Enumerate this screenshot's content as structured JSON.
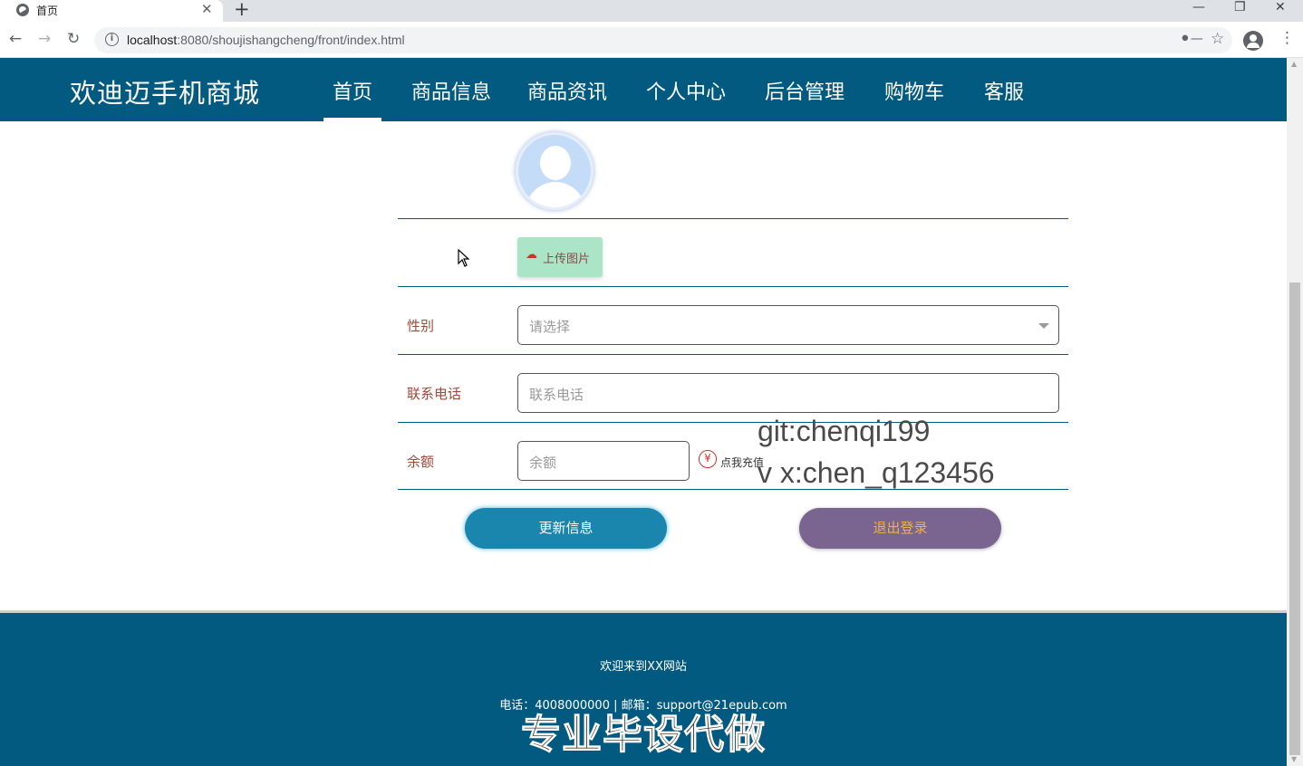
{
  "browser": {
    "tab_title": "首页",
    "tab_close": "✕",
    "new_tab": "+",
    "url_host": "localhost",
    "url_rest": ":8080/shoujishangcheng/front/index.html",
    "minimize": "—",
    "restore": "❐",
    "close": "✕"
  },
  "site": {
    "logo": "欢迪迈手机商城",
    "nav": [
      "首页",
      "商品信息",
      "商品资讯",
      "个人中心",
      "后台管理",
      "购物车",
      "客服"
    ],
    "active_nav": "首页"
  },
  "form": {
    "upload_label": "上传图片",
    "gender_label": "性别",
    "gender_placeholder": "请选择",
    "phone_label": "联系电话",
    "phone_placeholder": "联系电话",
    "balance_label": "余额",
    "balance_placeholder": "余额",
    "recharge_symbol": "¥",
    "recharge_label": "点我充值",
    "update_button": "更新信息",
    "logout_button": "退出登录"
  },
  "overlay": {
    "git": "git:chenqi199",
    "wx": "v x:chen_q123456"
  },
  "footer": {
    "welcome": "欢迎来到XX网站",
    "contact": "电话：4008000000 | 邮箱：support@21epub.com",
    "stamp": "专业毕设代做"
  },
  "colors": {
    "header_bg": "#035a80",
    "update_button_bg": "#1b86ad",
    "logout_button_bg": "#7a6591",
    "upload_button_bg": "#a9e5c6"
  }
}
